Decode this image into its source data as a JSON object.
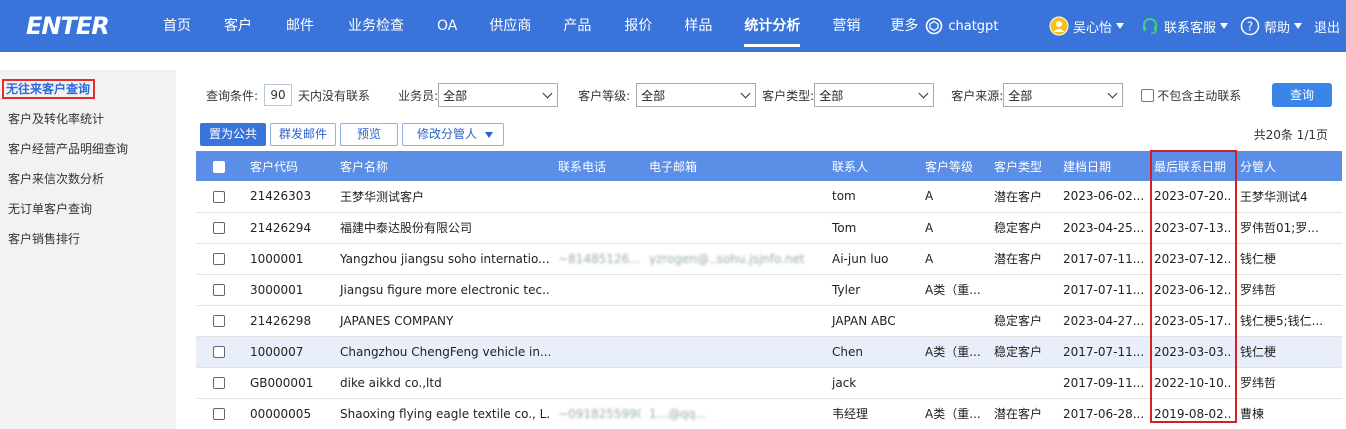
{
  "brand": {
    "logo": "ENTER",
    "accent": "#3a73d9",
    "highlight": "#d42020"
  },
  "nav": [
    "首页",
    "客户",
    "邮件",
    "业务检查",
    "OA",
    "供应商",
    "产品",
    "报价",
    "样品",
    "统计分析",
    "营销",
    "更多"
  ],
  "nav_active": "统计分析",
  "tools": {
    "chatgpt": "chatgpt",
    "user": "吴心怡",
    "service": "联系客服",
    "help": "帮助",
    "logout": "退出"
  },
  "sidebar": [
    {
      "label": "无往来客户查询",
      "active": true
    },
    {
      "label": "客户及转化率统计"
    },
    {
      "label": "客户经营产品明细查询"
    },
    {
      "label": "客户来信次数分析"
    },
    {
      "label": "无订单客户查询"
    },
    {
      "label": "客户销售排行"
    }
  ],
  "filter": {
    "condition_label": "查询条件:",
    "days": "90",
    "days_suffix": "天内没有联系",
    "salesman_label": "业务员:",
    "salesman_value": "全部",
    "level_label": "客户等级:",
    "level_value": "全部",
    "type_label": "客户类型:",
    "type_value": "全部",
    "source_label": "客户来源:",
    "source_value": "全部",
    "exclude_label": "不包含主动联系",
    "query_button": "查询"
  },
  "actions": {
    "to_public": "置为公共",
    "mass_mail": "群发邮件",
    "preview": "预览",
    "change_owner": "修改分管人"
  },
  "pager": "共20条 1/1页",
  "table": {
    "columns": [
      "客户代码",
      "客户名称",
      "联系电话",
      "电子邮箱",
      "联系人",
      "客户等级",
      "客户类型",
      "建档日期",
      "最后联系日期",
      "分管人"
    ],
    "rows": [
      [
        "21426303",
        "王梦华测试客户",
        "",
        "",
        "tom",
        "A",
        "潜在客户",
        "2023-06-02...",
        "2023-07-20...",
        "王梦华测试4"
      ],
      [
        "21426294",
        "福建中泰达股份有限公司",
        "",
        "",
        "Tom",
        "A",
        "稳定客户",
        "2023-04-25...",
        "2023-07-13...",
        "罗伟哲01;罗..."
      ],
      [
        "1000001",
        "Yangzhou jiangsu soho internatio...",
        "~81485126...",
        "yzrogen@..sohu.jsjnfo.net",
        "Ai-jun luo",
        "A",
        "潜在客户",
        "2017-07-11...",
        "2023-07-12...",
        "钱仁梗"
      ],
      [
        "3000001",
        "Jiangsu figure more electronic tec...",
        "",
        "",
        "Tyler",
        "A类（重...",
        "",
        "2017-07-11...",
        "2023-06-12...",
        "罗纬哲"
      ],
      [
        "21426298",
        "JAPANES COMPANY",
        "",
        "",
        "JAPAN ABC",
        "",
        "稳定客户",
        "2023-04-27...",
        "2023-05-17...",
        "钱仁梗5;钱仁..."
      ],
      [
        "1000007",
        "Changzhou ChengFeng vehicle in...",
        "",
        "",
        "Chen",
        "A类（重...",
        "稳定客户",
        "2017-07-11...",
        "2023-03-03...",
        "钱仁梗"
      ],
      [
        "GB000001",
        "dike aikkd co.,ltd",
        "",
        "",
        "jack",
        "",
        "",
        "2017-09-11...",
        "2022-10-10...",
        "罗纬哲"
      ],
      [
        "00000005",
        "Shaoxing flying eagle textile co., L...",
        "~0918255990...",
        "1...@qq...",
        "韦经理",
        "A类（重...",
        "潜在客户",
        "2017-06-28...",
        "2019-08-02...",
        "曹楝"
      ]
    ]
  },
  "selected_row_index": 5
}
